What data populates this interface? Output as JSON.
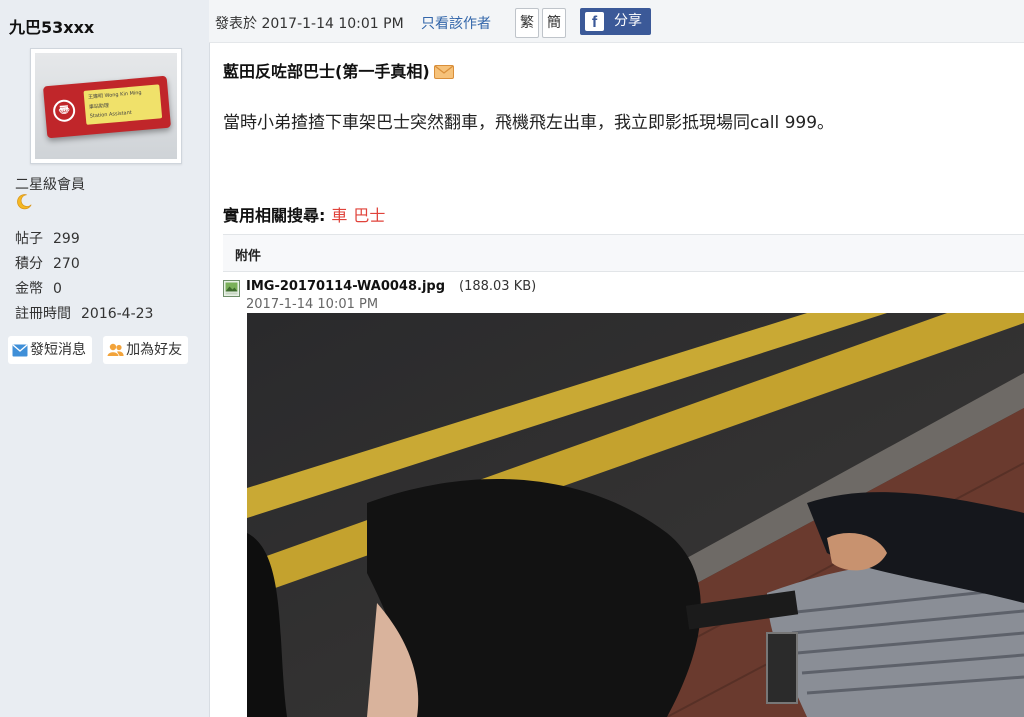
{
  "author": {
    "username": "九巴53xxx",
    "rank": "二星級會員",
    "stats": [
      {
        "label": "帖子",
        "value": "299"
      },
      {
        "label": "積分",
        "value": "270"
      },
      {
        "label": "金幣",
        "value": "0"
      },
      {
        "label": "註冊時間",
        "value": "2016-4-23"
      }
    ],
    "buttons": {
      "message": "發短消息",
      "add_friend": "加為好友"
    },
    "avatar_badge": {
      "name": "王建明 Wong Kin Ming",
      "dept": "車站助理",
      "role": "Station Assistant"
    }
  },
  "post": {
    "meta": "發表於 2017-1-14 10:01 PM",
    "author_only": "只看該作者",
    "trad_label": "繁",
    "simp_label": "簡",
    "share_label": "分享",
    "title": "藍田反咗部巴士(第一手真相)",
    "body": "當時小弟揸揸下車架巴士突然翻車，飛機飛左出車，我立即影抵現場同call 999。",
    "related_search_label": "實用相關搜尋:",
    "related_tags": [
      "車",
      "巴士"
    ]
  },
  "attachment": {
    "header": "附件",
    "filename": "IMG-20170114-WA0048.jpg",
    "size": "(188.03 KB)",
    "date": "2017-1-14 10:01 PM"
  },
  "colors": {
    "sidebar_bg": "#e9edf2",
    "link_blue": "#3366aa",
    "tag_red": "#e0433b",
    "facebook_blue": "#3b5998"
  }
}
